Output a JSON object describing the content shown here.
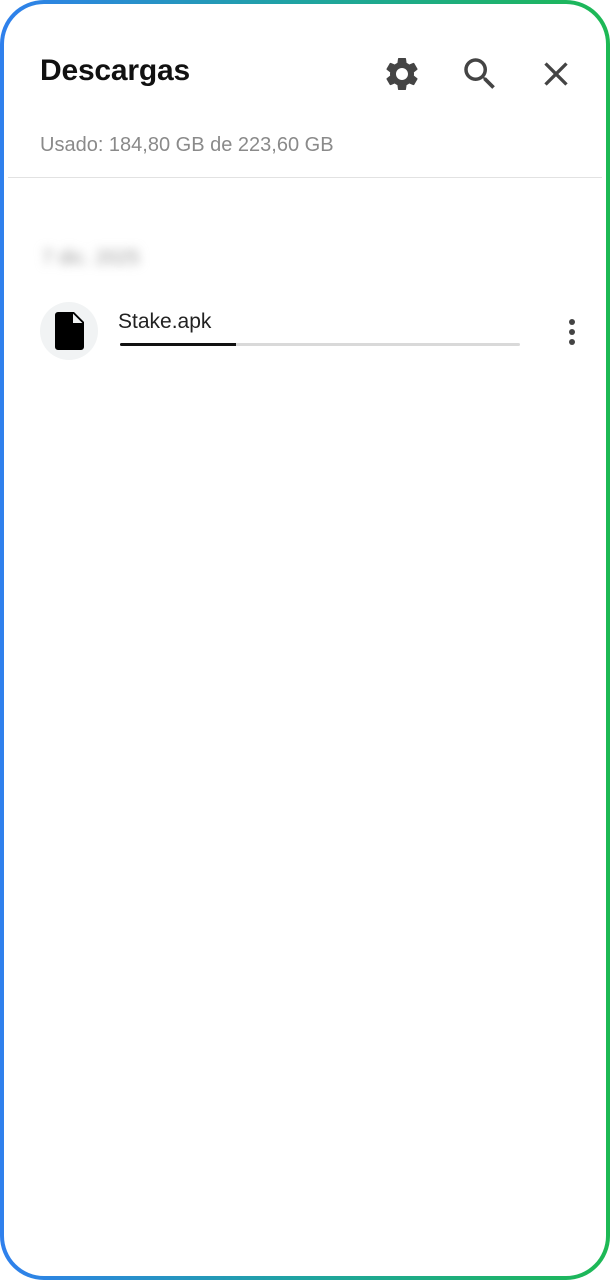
{
  "header": {
    "title": "Descargas",
    "icons": [
      "gear-icon",
      "search-icon",
      "close-icon"
    ]
  },
  "storage": {
    "text": "Usado: 184,80 GB de 223,60 GB"
  },
  "downloads": {
    "date_header": "7 dic. 2025",
    "items": [
      {
        "file_name": "Stake.apk",
        "icon": "file-icon",
        "progress": 0.29
      }
    ]
  },
  "colors": {
    "border_left": "#2f80ed",
    "border_right": "#1db954",
    "title": "#111111",
    "secondary_text": "#8a8a8a",
    "progress_fill": "#111111",
    "progress_track": "#d9d9d9"
  }
}
